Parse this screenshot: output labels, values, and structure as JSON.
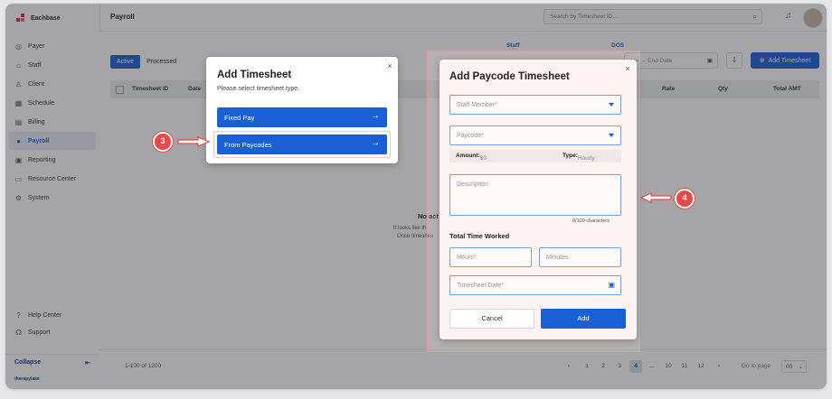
{
  "app": {
    "brand": "Eachbase",
    "page_title": "Payroll",
    "footer_brand": "therapylake"
  },
  "search": {
    "placeholder": "Search by Timesheet ID..."
  },
  "sidebar": {
    "items": [
      {
        "label": "Payer",
        "icon": "payer-icon"
      },
      {
        "label": "Staff",
        "icon": "staff-icon"
      },
      {
        "label": "Client",
        "icon": "client-icon"
      },
      {
        "label": "Schedule",
        "icon": "schedule-icon"
      },
      {
        "label": "Billing",
        "icon": "billing-icon"
      },
      {
        "label": "Payroll",
        "icon": "payroll-icon",
        "active": true
      },
      {
        "label": "Reporting",
        "icon": "reporting-icon"
      },
      {
        "label": "Resource Center",
        "icon": "resource-center-icon"
      },
      {
        "label": "System",
        "icon": "system-icon"
      }
    ],
    "help_center": "Help Center",
    "support": "Support",
    "collapse": "Collapse"
  },
  "filters": {
    "tab_active": "Active",
    "tab_processed": "Processed",
    "staff_label": "Staff",
    "dos_label": "DOS",
    "date_range": "ate  →  End Date",
    "add_button": "Add Timesheet"
  },
  "table": {
    "headers": [
      "Timesheet ID",
      "Date",
      "Rate",
      "Qty",
      "Total AMT"
    ]
  },
  "empty_state": {
    "title": "No act",
    "line1": "It looks like th",
    "line2": "Once timeshee"
  },
  "pagination": {
    "info": "1-100 of 1200",
    "pages": [
      "1",
      "2",
      "3",
      "4",
      "...",
      "10",
      "11",
      "12"
    ],
    "current": "4",
    "goto": "Go to page",
    "page_size": "00"
  },
  "dialog_timesheet": {
    "title": "Add Timesheet",
    "subtitle": "Please select timesheet type.",
    "option_fixed": "Fixed Pay",
    "option_paycodes": "From Paycodes"
  },
  "dialog_paycode": {
    "title": "Add Paycode Timesheet",
    "staff_placeholder": "Staff Member*",
    "paycode_placeholder": "Paycode*",
    "amount_label": "Amount:",
    "amount_value": "$0",
    "type_label": "Type:",
    "type_value": "Hourly",
    "description_placeholder": "Description",
    "counter": "0/100 characters",
    "section_title": "Total Time Worked",
    "hours_placeholder": "Hours*",
    "minutes_placeholder": "Minutes",
    "date_placeholder": "Timesheet Date*",
    "cancel": "Cancel",
    "add": "Add"
  },
  "steps": {
    "three": "3",
    "four": "4"
  },
  "colors": {
    "primary": "#1b5fd6",
    "step_marker": "#e84848",
    "brand_red": "#d8283c"
  }
}
